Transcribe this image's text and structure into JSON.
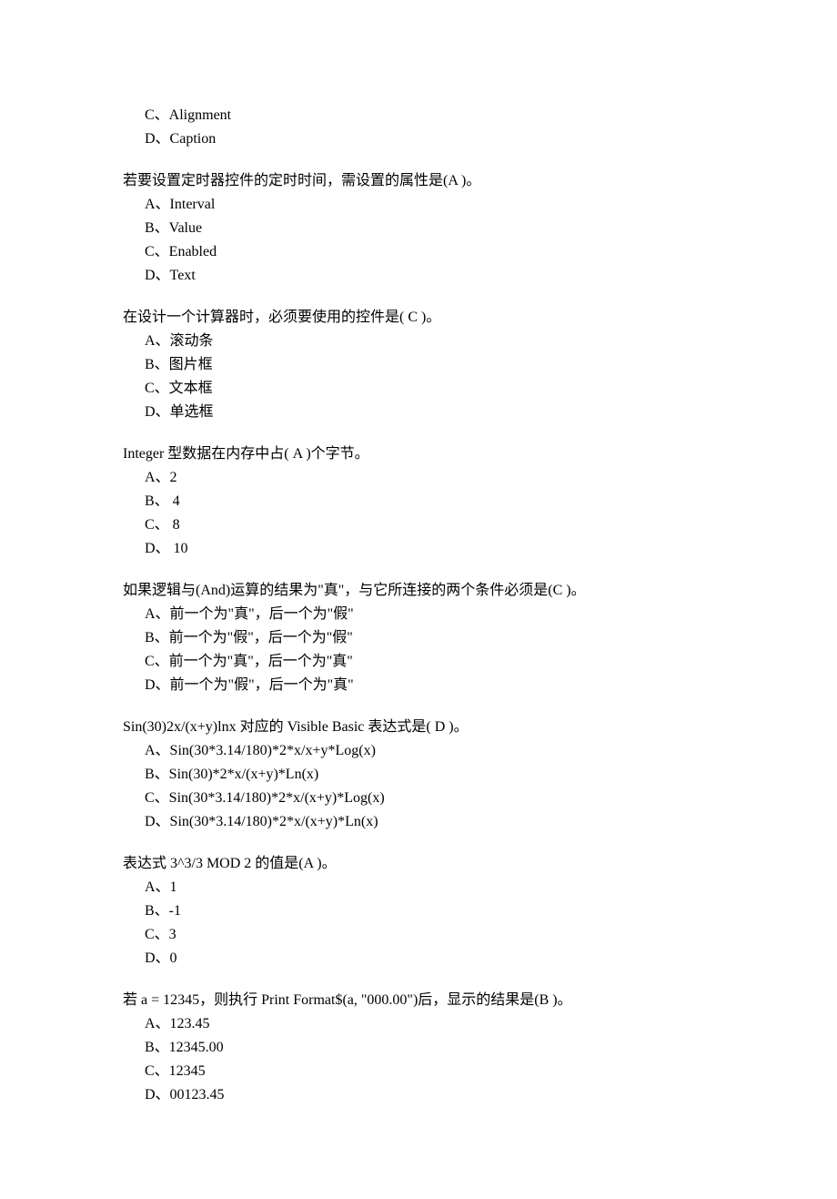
{
  "orphan": {
    "c": "C、Alignment",
    "d": "D、Caption"
  },
  "questions": [
    {
      "stem_pre": "若要设置定时器控件的定时时间，需设置的属性是(A",
      "stem_post": ")。",
      "opts": [
        "A、Interval",
        "B、Value",
        "C、Enabled",
        "D、Text"
      ]
    },
    {
      "stem_pre": "在设计一个计算器时，必须要使用的控件是( C",
      "stem_post": ")。",
      "opts": [
        "A、滚动条",
        "B、图片框",
        "C、文本框",
        "D、单选框"
      ]
    },
    {
      "stem_pre": "Integer 型数据在内存中占( A",
      "stem_post": ")个字节。",
      "opts": [
        "A、2",
        "B、 4",
        "C、 8",
        "D、 10"
      ]
    },
    {
      "stem_pre": "如果逻辑与(And)运算的结果为\"真\"，与它所连接的两个条件必须是(C",
      "stem_post": ")。",
      "opts": [
        "A、前一个为\"真\"，后一个为\"假\"",
        "B、前一个为\"假\"，后一个为\"假\"",
        "C、前一个为\"真\"，后一个为\"真\"",
        "D、前一个为\"假\"，后一个为\"真\""
      ]
    },
    {
      "stem_pre": "Sin(30)2x/(x+y)lnx  对应的 Visible Basic 表达式是( D",
      "stem_post": ")。",
      "opts": [
        "A、Sin(30*3.14/180)*2*x/x+y*Log(x)",
        "B、Sin(30)*2*x/(x+y)*Ln(x)",
        "C、Sin(30*3.14/180)*2*x/(x+y)*Log(x)",
        "D、Sin(30*3.14/180)*2*x/(x+y)*Ln(x)"
      ]
    },
    {
      "stem_pre": "表达式  3^3/3 MOD 2  的值是(A )。",
      "stem_post": "",
      "opts": [
        "A、1",
        "B、-1",
        "C、3",
        "D、0"
      ]
    },
    {
      "stem_pre": "若  a = 12345，则执行  Print Format$(a, \"000.00\")后，显示的结果是(B )。",
      "stem_post": "",
      "opts": [
        "A、123.45",
        "B、12345.00",
        "C、12345",
        "D、00123.45"
      ]
    }
  ]
}
